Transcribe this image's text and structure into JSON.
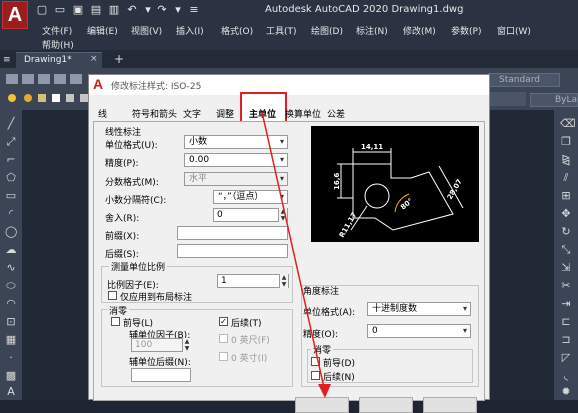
{
  "app": {
    "logo_letter": "A",
    "title": "Autodesk AutoCAD 2020    Drawing1.dwg"
  },
  "menus": [
    "文件(F)",
    "编辑(E)",
    "视图(V)",
    "插入(I)",
    "格式(O)",
    "工具(T)",
    "绘图(D)",
    "标注(N)",
    "修改(M)",
    "参数(P)",
    "窗口(W)"
  ],
  "menus_row2": [
    "帮助(H)"
  ],
  "file_tab": {
    "label": "Drawing1*",
    "close": "×",
    "add": "+"
  },
  "toolbar": {
    "text_style": "Standard",
    "layer": "ByLa"
  },
  "dialog": {
    "logo_letter": "A",
    "title": "修改标注样式: ISO-25",
    "tabs": [
      "线",
      "符号和箭头",
      "文字",
      "调整",
      "主单位",
      "换算单位",
      "公差"
    ],
    "active_tab": "主单位",
    "linear": {
      "heading": "线性标注",
      "unit_format_label": "单位格式(U):",
      "unit_format_value": "小数",
      "precision_label": "精度(P):",
      "precision_value": "0.00",
      "fraction_label": "分数格式(M):",
      "fraction_value": "水平",
      "decimal_sep_label": "小数分隔符(C):",
      "decimal_sep_value": "“，”（逗点）",
      "roundoff_label": "舍入(R):",
      "roundoff_value": "0",
      "prefix_label": "前缀(X):",
      "prefix_value": "",
      "suffix_label": "后缀(S):",
      "suffix_value": ""
    },
    "scale": {
      "heading": "测量单位比例",
      "factor_label": "比例因子(E):",
      "factor_value": "1",
      "layout_only_label": "仅应用到布局标注"
    },
    "zero_left": {
      "heading": "消零",
      "leading_label": "前导(L)",
      "leading_checked": false,
      "sub_factor_label": "辅单位因子(B):",
      "sub_factor_value": "100",
      "sub_suffix_label": "辅单位后缀(N):",
      "sub_suffix_value": "",
      "trailing_label": "后续(T)",
      "trailing_checked": true,
      "feet_label": "0 英尺(F)",
      "inches_label": "0 英寸(I)"
    },
    "angular": {
      "heading": "角度标注",
      "unit_format_label": "单位格式(A):",
      "unit_format_value": "十进制度数",
      "precision_label": "精度(O):",
      "precision_value": "0",
      "zero_heading": "消零",
      "leading_label": "前导(D)",
      "trailing_label": "后续(N)"
    },
    "preview_labels": [
      "14,11",
      "16,6",
      "28,07",
      "R11,17",
      "80°"
    ]
  },
  "colors": {
    "accent_red": "#e02020",
    "preview_line": "#ffffff",
    "preview_arc": "#f0b000"
  }
}
